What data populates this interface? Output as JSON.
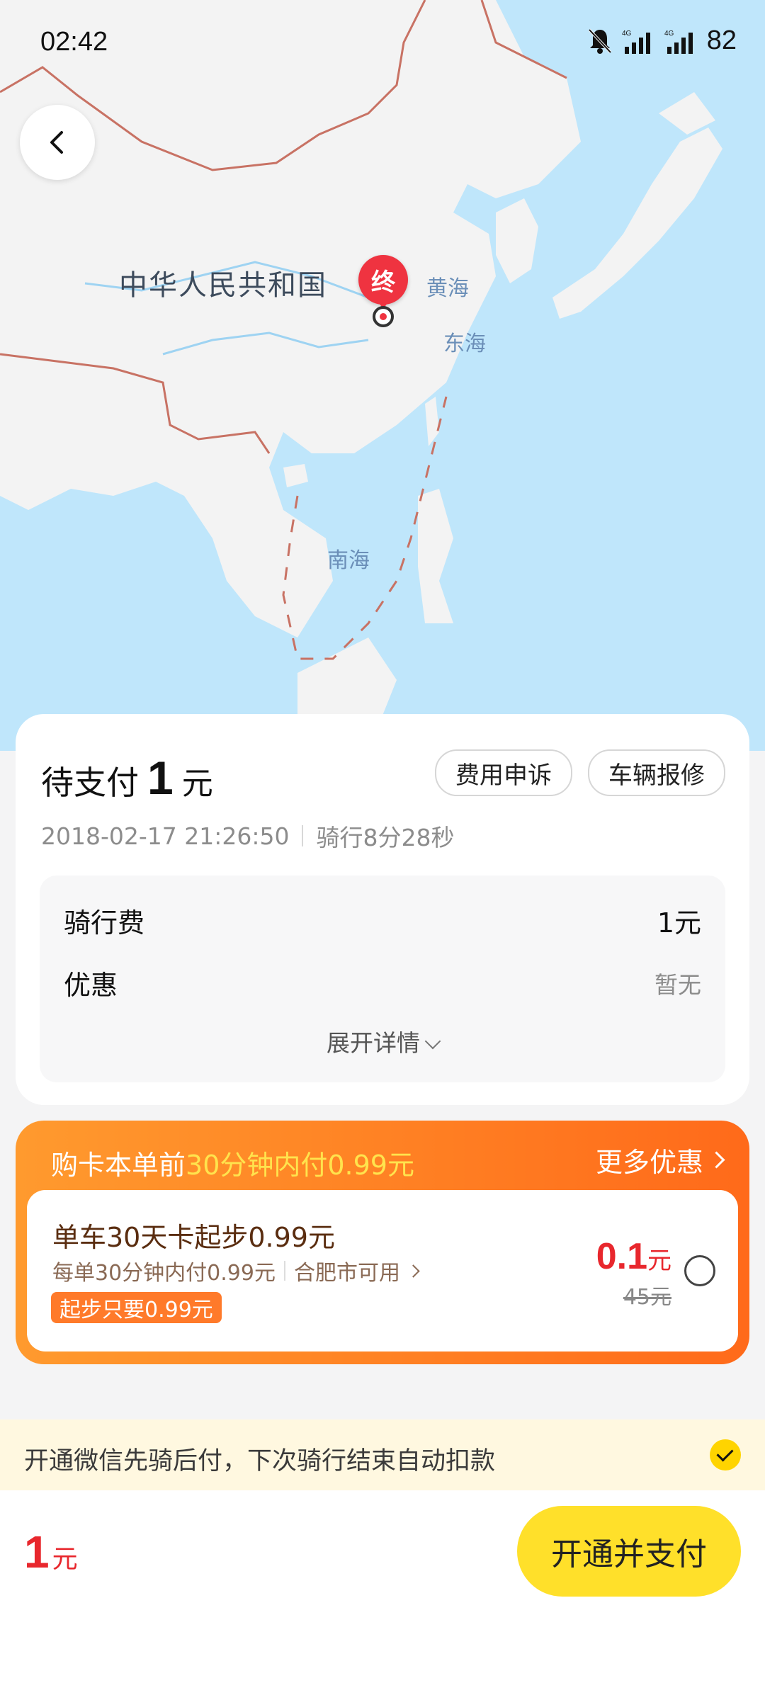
{
  "status_bar": {
    "time": "02:42",
    "battery": "82",
    "icons": [
      "bell-muted-icon",
      "signal-4g-icon",
      "signal-4g-icon"
    ]
  },
  "map": {
    "country": "中华人民共和国",
    "labels": {
      "yellow_sea": "黄海",
      "east_sea": "东海",
      "south_sea": "南海"
    },
    "end_marker": "终"
  },
  "order": {
    "title_prefix": "待支付",
    "amount": "1",
    "unit": "元",
    "complaint_button": "费用申诉",
    "repair_button": "车辆报修",
    "datetime": "2018-02-17 21:26:50",
    "duration": "骑行8分28秒",
    "fee_label": "骑行费",
    "fee_value": "1元",
    "discount_label": "优惠",
    "discount_value": "暂无",
    "expand_label": "展开详情"
  },
  "promo": {
    "head_prefix": "购卡本单前",
    "head_highlight": "30分钟内付0.99元",
    "more_label": "更多优惠",
    "offer_title": "单车30天卡起步0.99元",
    "offer_desc": "每单30分钟内付0.99元",
    "offer_city": "合肥市可用",
    "offer_tag": "起步只要0.99元",
    "price_now": "0.1",
    "price_unit": "元",
    "price_old": "45元"
  },
  "wechat": {
    "text": "开通微信先骑后付，下次骑行结束自动扣款"
  },
  "footer": {
    "total": "1",
    "unit": "元",
    "pay_button": "开通并支付"
  },
  "colors": {
    "sea": "#bfe6fb",
    "land": "#f3f3f3",
    "accent_red": "#e8272d",
    "promo_orange": "#ff6a1a",
    "highlight_yellow": "#ffe34d",
    "pay_yellow": "#ffe02a"
  }
}
